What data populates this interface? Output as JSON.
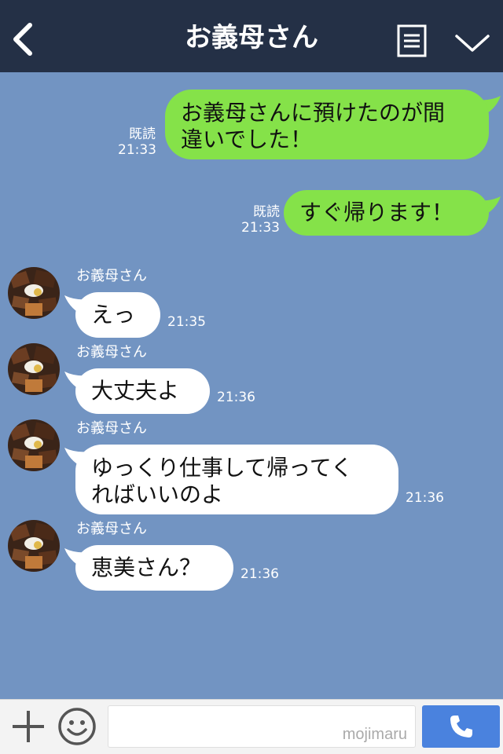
{
  "header": {
    "title": "お義母さん",
    "back_icon": "chevron-left-icon",
    "menu_icon": "note-list-icon",
    "collapse_icon": "chevron-down-icon"
  },
  "colors": {
    "header_bg": "#243046",
    "chat_bg": "#7294c2",
    "my_bubble": "#85e249",
    "their_bubble": "#ffffff",
    "send_button": "#4a82de"
  },
  "messages": [
    {
      "from": "me",
      "line1": "お義母さんに預けたのが間",
      "line2": "違いでした！",
      "read": "既読",
      "time": "21:33"
    },
    {
      "from": "me",
      "line1": "すぐ帰ります！",
      "read": "既読",
      "time": "21:33"
    },
    {
      "from": "them",
      "sender": "お義母さん",
      "line1": "えっ",
      "time": "21:35"
    },
    {
      "from": "them",
      "sender": "お義母さん",
      "line1": "大丈夫よ",
      "time": "21:36"
    },
    {
      "from": "them",
      "sender": "お義母さん",
      "line1": "ゆっくり仕事して帰ってく",
      "line2": "ればいいのよ",
      "time": "21:36"
    },
    {
      "from": "them",
      "sender": "お義母さん",
      "line1": "恵美さん？",
      "time": "21:36"
    }
  ],
  "footer": {
    "add_icon": "plus-icon",
    "emoji_icon": "smiley-icon",
    "input_value": "",
    "watermark": "mojimaru",
    "call_icon": "phone-icon"
  }
}
